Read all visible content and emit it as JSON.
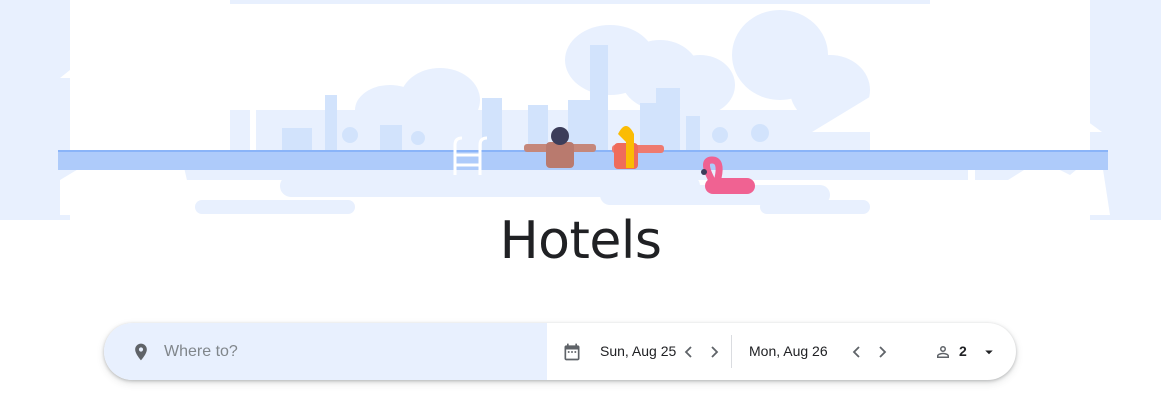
{
  "page": {
    "title": "Hotels"
  },
  "search": {
    "where_placeholder": "Where to?",
    "where_value": "",
    "check_in": "Sun, Aug 25",
    "check_out": "Mon, Aug 26",
    "guests": "2"
  },
  "icons": {
    "location": "location-pin-icon",
    "calendar": "calendar-icon",
    "prev": "chevron-left-icon",
    "next": "chevron-right-icon",
    "person": "person-icon",
    "dropdown": "caret-down-icon"
  },
  "colors": {
    "search_field_bg": "#e8f0fe",
    "illustration_light": "#e8f0fe",
    "illustration_mid": "#d2e3fc",
    "pool": "#aecbfa",
    "flamingo": "#f06292"
  }
}
